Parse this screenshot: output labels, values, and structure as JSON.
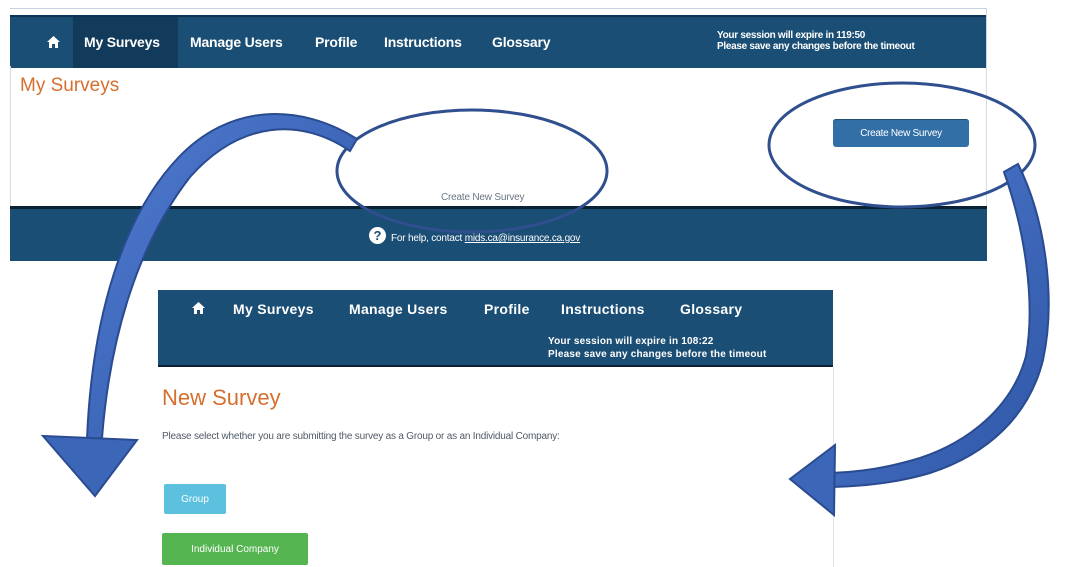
{
  "top_screen": {
    "nav": {
      "items": [
        "My Surveys",
        "Manage Users",
        "Profile",
        "Instructions",
        "Glossary"
      ]
    },
    "session": {
      "line1": "Your session will expire in 119:50",
      "line2": "Please save any changes before the timeout"
    },
    "page_title": "My Surveys",
    "center_link": "Create New Survey",
    "create_button": "Create New Survey",
    "help_text": "For help, contact",
    "help_email": "mids.ca@insurance.ca.gov"
  },
  "bottom_screen": {
    "nav": {
      "items": [
        "My Surveys",
        "Manage Users",
        "Profile",
        "Instructions",
        "Glossary"
      ]
    },
    "session": {
      "line1": "Your session will expire in 108:22",
      "line2": "Please save any changes before the timeout"
    },
    "page_title": "New Survey",
    "description": "Please select whether you are submitting the survey as a Group or as an Individual Company:",
    "group_button": "Group",
    "individual_button": "Individual Company"
  },
  "icons": {
    "home": "home-icon",
    "help": "question-circle-icon"
  },
  "colors": {
    "nav_bg": "#1b4e74",
    "title_orange": "#d66f2e",
    "create_blue": "#326fa6",
    "group_cyan": "#5bc1df",
    "individual_green": "#55b551",
    "annotation_blue": "#3c67b8"
  }
}
